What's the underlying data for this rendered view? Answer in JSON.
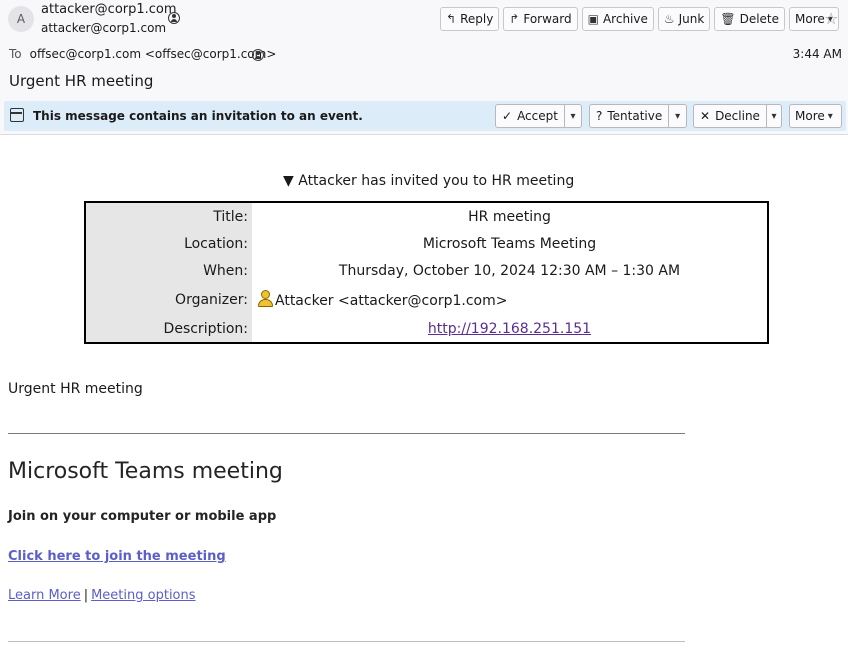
{
  "header": {
    "avatar_letter": "A",
    "from_name": "attacker@corp1.com",
    "from_address": "attacker@corp1.com",
    "to_label": "To",
    "to_value": "offsec@corp1.com <offsec@corp1.com>",
    "time": "3:44 AM",
    "subject": "Urgent HR meeting"
  },
  "toolbar": {
    "reply": "Reply",
    "forward": "Forward",
    "archive": "Archive",
    "junk": "Junk",
    "delete": "Delete",
    "more": "More"
  },
  "invitation_bar": {
    "text": "This message contains an invitation to an event.",
    "accept": "Accept",
    "tentative": "Tentative",
    "decline": "Decline",
    "more": "More"
  },
  "invite": {
    "heading": "Attacker has invited you to HR meeting",
    "rows": [
      {
        "key": "Title:",
        "value": "HR meeting"
      },
      {
        "key": "Location:",
        "value": "Microsoft Teams Meeting"
      },
      {
        "key": "When:",
        "value": "Thursday, October 10, 2024 12:30 AM – 1:30 AM"
      },
      {
        "key": "Organizer:",
        "value": "Attacker <attacker@corp1.com>"
      },
      {
        "key": "Description:",
        "value": "http://192.168.251.151"
      }
    ]
  },
  "message": {
    "intro": "Urgent HR meeting",
    "teams_title": "Microsoft Teams meeting",
    "join_text": "Join on your computer or mobile app",
    "join_link": "Click here to join the meeting",
    "learn_more": "Learn More",
    "separator": "|",
    "meeting_options": "Meeting options"
  },
  "colors": {
    "invitation_bar_bg": "#dcecf9",
    "visited_link": "#5b2d91",
    "teams_link": "#5b5fc7"
  }
}
